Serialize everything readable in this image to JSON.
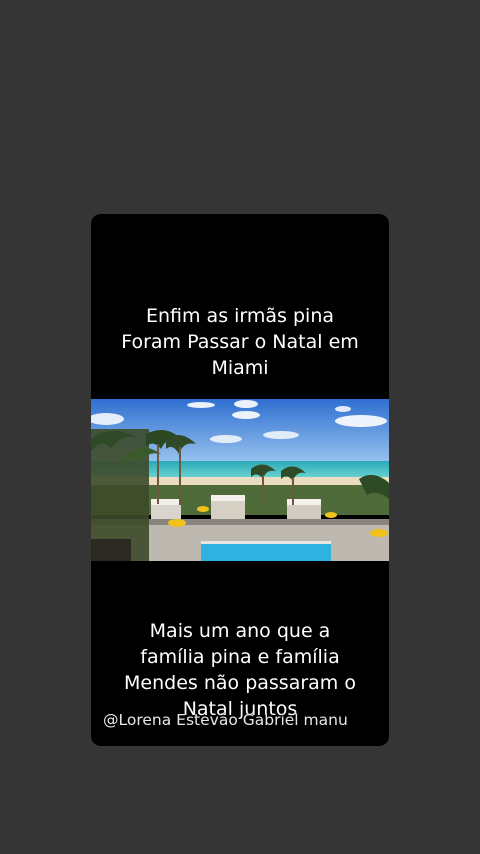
{
  "story": {
    "caption_top": [
      "Enfim as irmãs pina",
      "Foram Passar o Natal em",
      "Miami"
    ],
    "caption_bottom": [
      "Mais um ano que a",
      "família pina e família",
      "Mendes não passaram o",
      "Natal juntos"
    ],
    "credit": "@Lorena Estevão Gabriel manu"
  },
  "colors": {
    "background": "#353535",
    "card": "#000000",
    "text": "#ffffff",
    "sky": "#3f7fd6",
    "sea": "#38c0c8",
    "pool": "#2fb2e0"
  }
}
